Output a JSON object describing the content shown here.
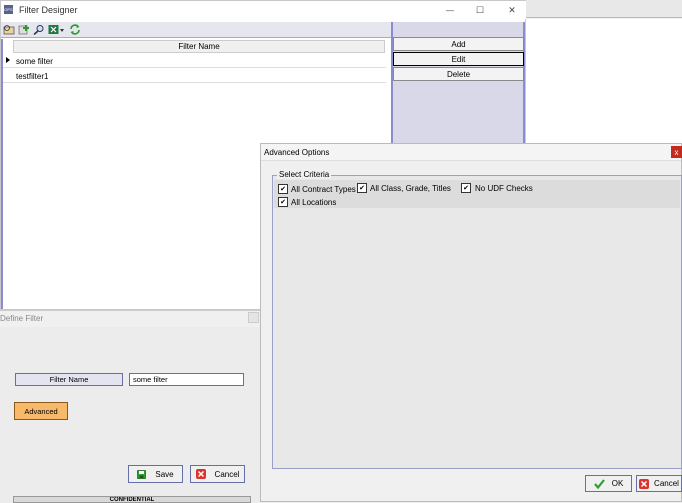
{
  "filter_designer": {
    "title": "Filter Designer",
    "app_icon_text": "OPS",
    "window_controls": {
      "minimize": "—",
      "maximize": "☐",
      "close": "✕"
    },
    "toolbar_icons": [
      "open-icon",
      "add-icon",
      "search-icon",
      "excel-export-icon",
      "refresh-icon"
    ],
    "grid": {
      "column_header": "Filter Name",
      "rows": [
        {
          "name": "some filter",
          "selected": true
        },
        {
          "name": "testfilter1",
          "selected": false
        }
      ]
    },
    "buttons": {
      "add": "Add",
      "edit": "Edit",
      "delete": "Delete"
    }
  },
  "define_filter": {
    "title": "Define Filter",
    "filter_name_label": "Filter Name",
    "filter_name_value": "some filter",
    "advanced_label": "Advanced",
    "save_label": "Save",
    "cancel_label": "Cancel",
    "footer_text": "CONFIDENTIAL"
  },
  "advanced_options": {
    "title": "Advanced Options",
    "close_glyph": "x",
    "group_label": "Select Criteria",
    "criteria": [
      {
        "label": "All Contract Types",
        "checked": true
      },
      {
        "label": "All Class, Grade, Titles",
        "checked": true
      },
      {
        "label": "No UDF Checks",
        "checked": true
      },
      {
        "label": "All Locations",
        "checked": true
      }
    ],
    "ok_label": "OK",
    "cancel_label": "Cancel"
  },
  "colors": {
    "accent_border": "#8b8bcf",
    "advanced_button": "#f8b96a",
    "ok_icon": "#2e9e2e",
    "cancel_icon": "#d9342b",
    "close_button": "#c42b1c"
  }
}
